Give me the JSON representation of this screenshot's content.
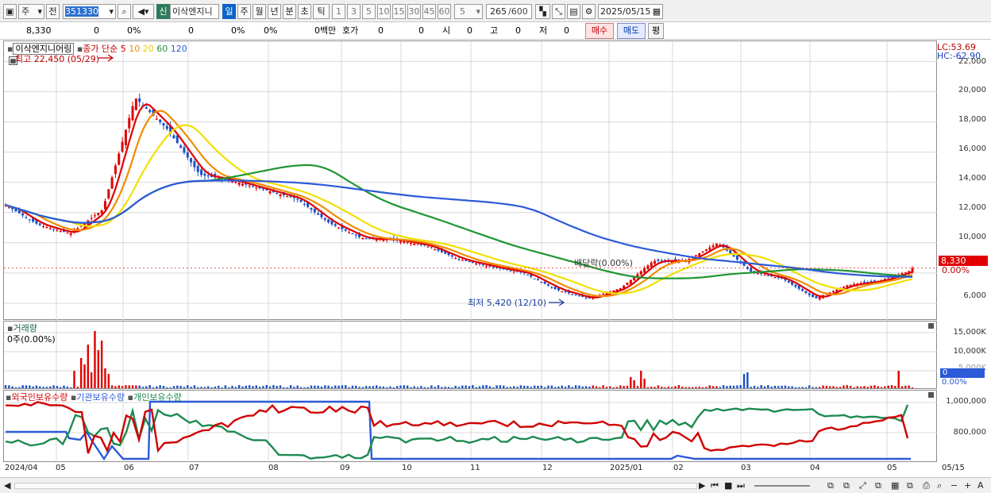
{
  "toolbar": {
    "stock_type": "주",
    "prev_label": "전",
    "code": "351330",
    "badge_new": "신",
    "stock_name": "이삭엔지니",
    "periods": [
      "일",
      "주",
      "월",
      "년",
      "분",
      "초",
      "틱"
    ],
    "selected_period": "일",
    "intervals": [
      "1",
      "3",
      "5",
      "10",
      "15",
      "30",
      "45",
      "60"
    ],
    "interval_select": "5",
    "count": "265",
    "count_total": "/600",
    "date": "2025/05/15"
  },
  "quote": {
    "price": "8,330",
    "change": "0",
    "change_pct": "0%",
    "volume": "0",
    "vol_pct": "0%",
    "vol_pct2": "0%",
    "amount": "0백만",
    "hoga_label": "호가",
    "hoga1": "0",
    "hoga2": "0",
    "open_label": "시",
    "open": "0",
    "high_label": "고",
    "high": "0",
    "low_label": "저",
    "low": "0",
    "buy_button": "매수",
    "sell_button": "매도",
    "eval_button": "평"
  },
  "price_panel": {
    "legend_name": "이삭엔지니어링",
    "legend_ma": "종가 단순",
    "ma_periods": [
      "5",
      "10",
      "20",
      "60",
      "120"
    ],
    "ma_colors": [
      "#e00000",
      "#f08c00",
      "#f0e000",
      "#1e9632",
      "#2c5ad8"
    ],
    "lc": "LC:53.69",
    "hc": "HC:-62.90",
    "high_annot": "최고 22,450 (05/29)",
    "low_annot": "최저 5,420 (12/10)",
    "dividend_annot": "배당락(0.00%)",
    "price_tag": "8,330",
    "price_pct": "0.00%",
    "y_ticks": [
      "22,000",
      "20,000",
      "18,000",
      "16,000",
      "14,000",
      "12,000",
      "10,000",
      "8,000",
      "6,000"
    ]
  },
  "volume_panel": {
    "legend": "거래량",
    "value": "0주(0.00%)",
    "y_ticks": [
      "15,000K",
      "10,000K",
      "5,000K"
    ],
    "tag": "0",
    "tag_pct": "0.00%"
  },
  "holdings_panel": {
    "legend_foreign": "외국인보유수량",
    "legend_inst": "기관보유수량",
    "legend_indiv": "개인보유수량",
    "y_ticks": [
      "1,000,000",
      "800,000"
    ]
  },
  "x_axis": [
    "2024/04",
    "05",
    "06",
    "07",
    "08",
    "09",
    "10",
    "11",
    "12",
    "2025/01",
    "02",
    "03",
    "04",
    "05",
    "05/15"
  ],
  "colors": {
    "up": "#e00000",
    "down": "#1a50c8",
    "accent": "#0a64c8",
    "grid": "#d8d8d8"
  },
  "chart_data": {
    "type": "candlestick",
    "period": "daily",
    "ylim": [
      5000,
      22700
    ],
    "close_series": [
      12500,
      11200,
      10600,
      12200,
      19600,
      17500,
      14500,
      14100,
      13500,
      12900,
      11300,
      10300,
      10200,
      9800,
      8900,
      8400,
      8000,
      6900,
      6300,
      7000,
      8800,
      8800,
      10000,
      8100,
      7600,
      6300,
      7200,
      7500,
      8200
    ],
    "annotations": [
      {
        "text": "최고 22,450 (05/29)",
        "value": 22450
      },
      {
        "text": "최저 5,420 (12/10)",
        "value": 5420
      },
      {
        "text": "배당락(0.00%)"
      }
    ],
    "last_price": 8330
  }
}
